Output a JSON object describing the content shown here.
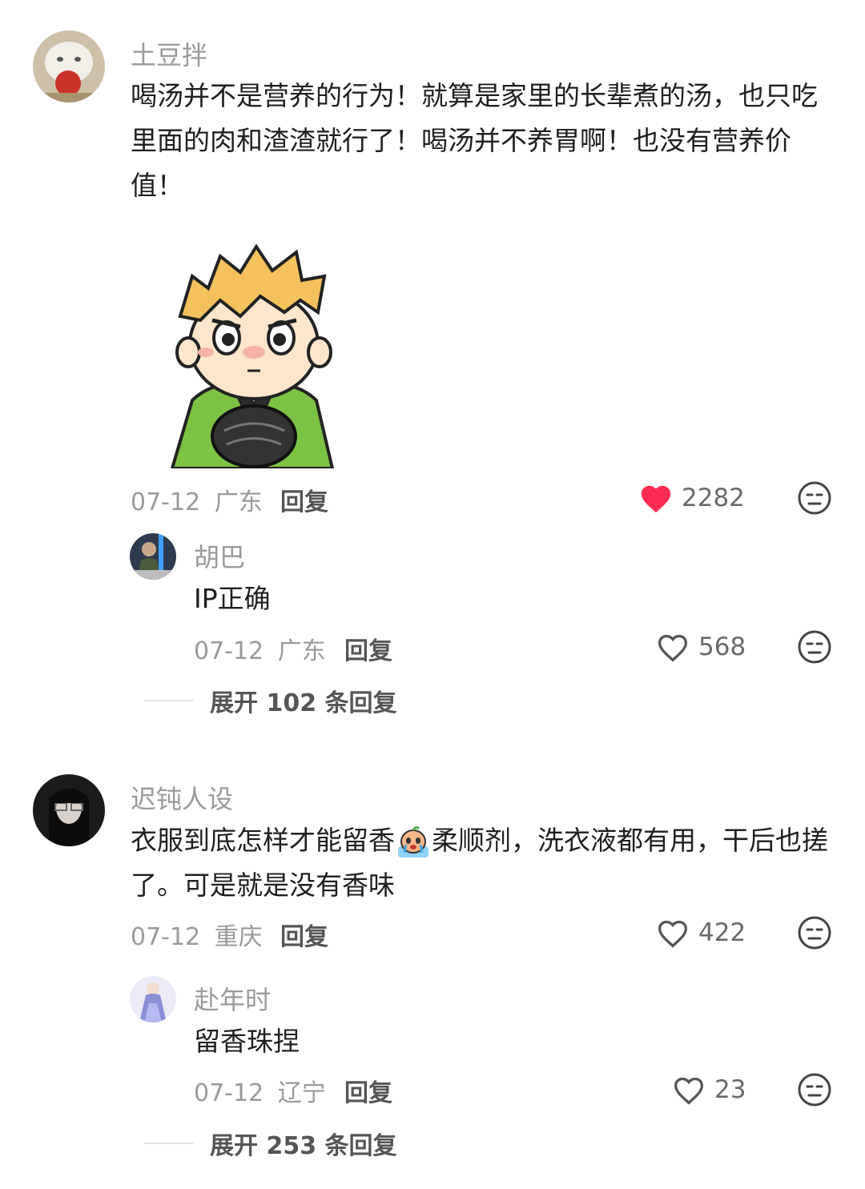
{
  "comments": [
    {
      "user": "土豆拌",
      "text": "喝汤并不是营养的行为！就算是家里的长辈煮的汤，也只吃里面的肉和渣渣就行了！喝汤并不养胃啊！也没有营养价值！",
      "date": "07-12",
      "location": "广东",
      "reply_label": "回复",
      "likes": "2282",
      "liked": true,
      "sticker": "cartoon-boy-sticker",
      "sub_reply": {
        "user": "胡巴",
        "text": "IP正确",
        "date": "07-12",
        "location": "广东",
        "reply_label": "回复",
        "likes": "568"
      },
      "expand_label": "展开 102 条回复"
    },
    {
      "user": "迟钝人设",
      "text_before_emoji": "衣服到底怎样才能留香",
      "emoji": "crying-emoji",
      "text_after_emoji": "柔顺剂，洗衣液都有用，干后也搓了。可是就是没有香味",
      "date": "07-12",
      "location": "重庆",
      "reply_label": "回复",
      "likes": "422",
      "liked": false,
      "sub_reply": {
        "user": "赴年时",
        "text": "留香珠捏",
        "date": "07-12",
        "location": "辽宁",
        "reply_label": "回复",
        "likes": "23"
      },
      "expand_label": "展开 253 条回复"
    }
  ],
  "colors": {
    "liked_heart": "#fe2c55",
    "muted_text": "#9a9a9a",
    "body_text": "#1f1f1f"
  }
}
